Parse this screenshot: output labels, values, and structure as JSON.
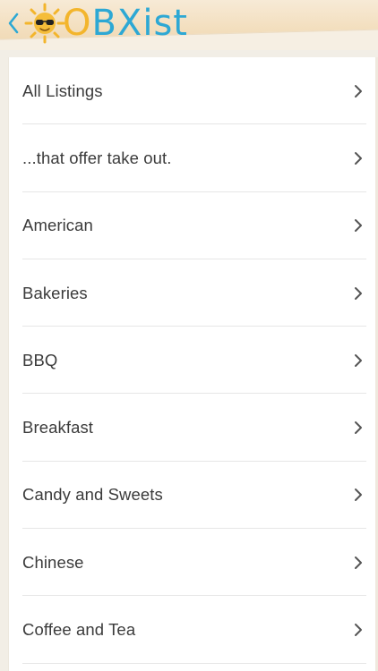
{
  "header": {
    "logo_pre": "",
    "logo_o": "O",
    "logo_rest": "BXist"
  },
  "colors": {
    "accent": "#2da8d4",
    "sun": "#f3b52c",
    "text": "#3b3b3b",
    "chevron": "#555555"
  },
  "list": {
    "items": [
      {
        "label": "All Listings"
      },
      {
        "label": "...that offer take out."
      },
      {
        "label": "American"
      },
      {
        "label": "Bakeries"
      },
      {
        "label": "BBQ"
      },
      {
        "label": "Breakfast"
      },
      {
        "label": "Candy and Sweets"
      },
      {
        "label": "Chinese"
      },
      {
        "label": "Coffee and Tea"
      }
    ]
  },
  "icons": {
    "back": "chevron-left-icon",
    "sun": "sun-sunglasses-icon",
    "row_arrow": "chevron-right-icon"
  }
}
